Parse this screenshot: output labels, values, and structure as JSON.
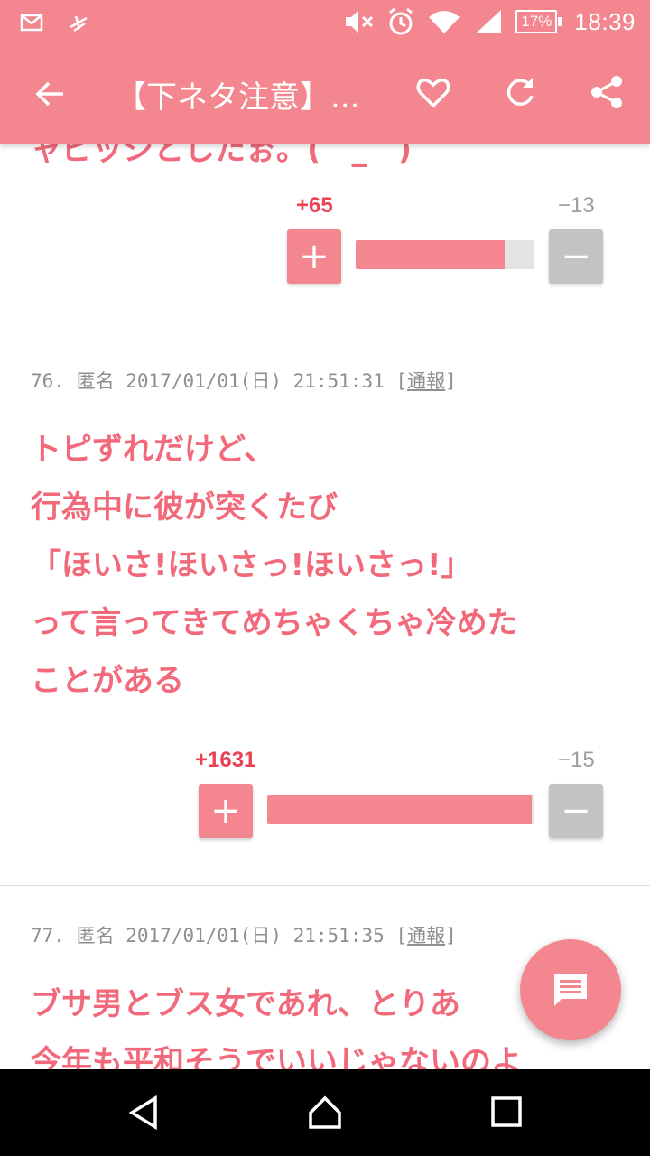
{
  "status_bar": {
    "time": "18:39",
    "battery": "17%",
    "icons": [
      "mail-icon",
      "airplane-mode-icon",
      "mute-icon",
      "alarm-icon",
      "wifi-icon",
      "signal-icon",
      "battery-icon"
    ]
  },
  "app_bar": {
    "title": "【下ネタ注意】...",
    "icons": [
      "back-arrow-icon",
      "heart-icon",
      "refresh-icon",
      "share-icon"
    ]
  },
  "colors": {
    "accent": "#f3868f",
    "text_pink": "#f1697a",
    "plus_count": "#ea4153",
    "minus_gray": "#9e9e9e"
  },
  "posts": [
    {
      "partial_text": "ャビッシとしたぉ。(゜_゜)",
      "plus_count": "+65",
      "minus_count": "−13",
      "plus_ratio": 0.833,
      "plus_label": "+",
      "minus_label": "−"
    },
    {
      "number": "76.",
      "author": "匿名",
      "date": "2017/01/01(日)",
      "time": "21:51:31",
      "report_open": "[",
      "report_label": "通報",
      "report_close": "]",
      "body": "トピずれだけど、\n行為中に彼が突くたび\n「ほいさ!ほいさっ!ほいさっ!」\nって言ってきてめちゃくちゃ冷めた\nことがある",
      "plus_count": "+1631",
      "minus_count": "−15",
      "plus_ratio": 0.991,
      "plus_label": "+",
      "minus_label": "−"
    },
    {
      "number": "77.",
      "author": "匿名",
      "date": "2017/01/01(日)",
      "time": "21:51:35",
      "report_open": "[",
      "report_label": "通報",
      "report_close": "]",
      "body": "ブサ男とブス女であれ、とりあ\n今年も平和そうでいいじゃないのよ"
    }
  ],
  "fab": {
    "icon": "comment-icon"
  },
  "nav_bar": {
    "icons": [
      "back-triangle-icon",
      "home-icon",
      "recents-icon"
    ]
  }
}
